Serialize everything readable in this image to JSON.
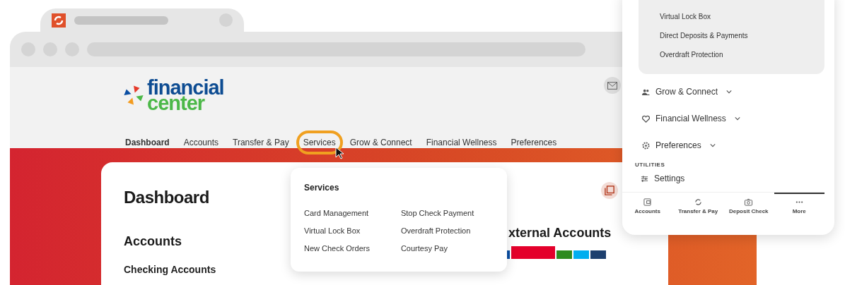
{
  "browser": {
    "logo": {
      "line_1": "financial",
      "line_2": "center"
    },
    "nav": [
      {
        "label": "Dashboard",
        "active": true,
        "highlighted": false
      },
      {
        "label": "Accounts",
        "active": false,
        "highlighted": false
      },
      {
        "label": "Transfer & Pay",
        "active": false,
        "highlighted": false
      },
      {
        "label": "Services",
        "active": false,
        "highlighted": true
      },
      {
        "label": "Grow & Connect",
        "active": false,
        "highlighted": false
      },
      {
        "label": "Financial Wellness",
        "active": false,
        "highlighted": false
      },
      {
        "label": "Preferences",
        "active": false,
        "highlighted": false
      }
    ],
    "page": {
      "title": "Dashboard",
      "accounts_heading": "Accounts",
      "accounts_subheading": "Checking Accounts",
      "external_heading": "xternal Accounts"
    },
    "dropdown": {
      "title": "Services",
      "items": [
        "Card Management",
        "Virtual Lock Box",
        "New Check Orders",
        "Stop Check Payment",
        "Overdraft Protection",
        "Courtesy Pay"
      ]
    }
  },
  "phone": {
    "submenu": [
      "Virtual Lock Box",
      "Direct Deposits & Payments",
      "Overdraft Protection"
    ],
    "menu": [
      {
        "label": "Grow & Connect",
        "kind": "people"
      },
      {
        "label": "Financial Wellness",
        "kind": "heart"
      },
      {
        "label": "Preferences",
        "kind": "gear"
      }
    ],
    "section": "UTILITIES",
    "utility": "Settings",
    "tabs": [
      {
        "label": "Accounts",
        "kind": "wallet",
        "selected": false
      },
      {
        "label": "Transfer & Pay",
        "kind": "sync",
        "selected": false
      },
      {
        "label": "Deposit Check",
        "kind": "camera",
        "selected": false
      },
      {
        "label": "More",
        "kind": "dots",
        "selected": true
      }
    ]
  }
}
